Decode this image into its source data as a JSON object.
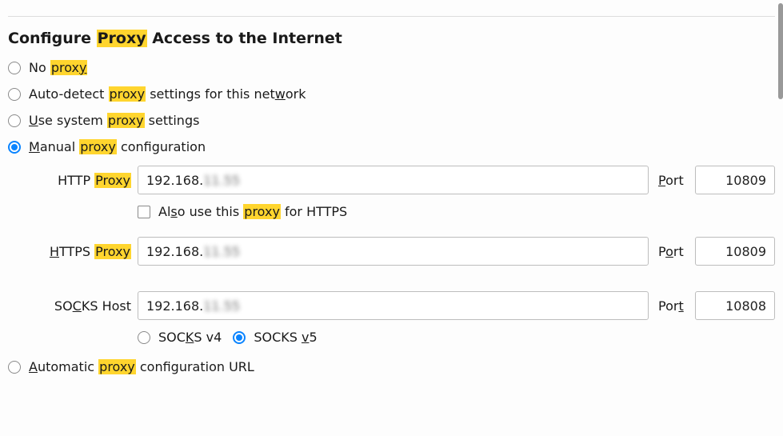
{
  "heading": {
    "pre": "Configure ",
    "hl": "Proxy",
    "post": " Access to the Internet"
  },
  "options": {
    "no_proxy": {
      "pre": "No ",
      "hl": "proxy",
      "post": "",
      "ul_index": 6
    },
    "auto_detect": {
      "pre": "Auto-detect ",
      "hl": "proxy",
      "post": " settings for this network",
      "ul_char": "w"
    },
    "system": {
      "pre": "Use system ",
      "hl": "proxy",
      "post": " settings",
      "ul_lead": "U"
    },
    "manual": {
      "pre": "Manual ",
      "hl": "proxy",
      "post": " configuration",
      "ul_lead": "M"
    },
    "auto_url": {
      "pre": "Automatic ",
      "hl": "proxy",
      "post": " configuration URL",
      "ul_lead": "A"
    }
  },
  "fields": {
    "http": {
      "label_pre": "HTTP ",
      "label_hl": "Proxy",
      "value": "192.168.",
      "value_blur": "11.55",
      "port_label": "Port",
      "port_ul": "P",
      "port_value": "10809"
    },
    "also_https": {
      "pre": "Also use this ",
      "hl": "proxy",
      "post": " for HTTPS",
      "ul_char": "s"
    },
    "https": {
      "label_pre": "HTTPS ",
      "label_hl": "Proxy",
      "label_ul": "H",
      "value": "192.168.",
      "value_blur": "11.55",
      "port_label": "Port",
      "port_ul": "o",
      "port_value": "10809"
    },
    "socks": {
      "label": "SOCKS Host",
      "label_ul": "C",
      "value": "192.168.",
      "value_blur": "11.55",
      "port_label": "Port",
      "port_value": "10808"
    },
    "socks_v4": {
      "label": "SOCKS v4",
      "ul": "K"
    },
    "socks_v5": {
      "label": "SOCKS v5",
      "ul": "v"
    }
  }
}
